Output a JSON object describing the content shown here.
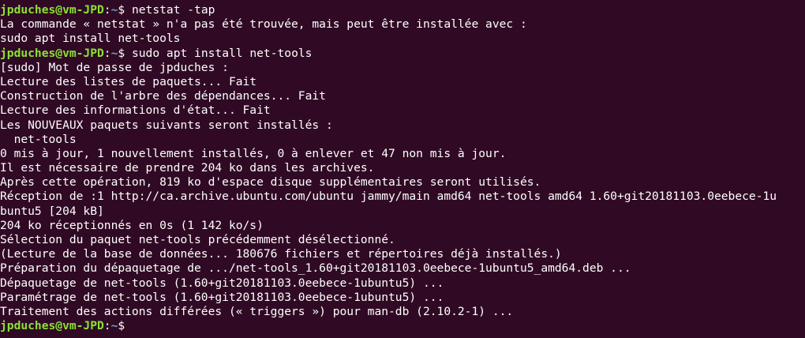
{
  "terminal": {
    "prompt_user_host": "jpduches@vm-JPD",
    "prompt_path": "~",
    "prompt_symbol": "$",
    "top_fragment": "  ~~~~ ~~~~~~~~ ~~~~~~~~~~~~ ~~~~~~~~",
    "lines": [
      {
        "type": "prompt",
        "command": "netstat -tap"
      },
      {
        "type": "text",
        "text": "La commande « netstat » n'a pas été trouvée, mais peut être installée avec :"
      },
      {
        "type": "text",
        "text": "sudo apt install net-tools"
      },
      {
        "type": "prompt",
        "command": "sudo apt install net-tools"
      },
      {
        "type": "text",
        "text": "[sudo] Mot de passe de jpduches :"
      },
      {
        "type": "text",
        "text": "Lecture des listes de paquets... Fait"
      },
      {
        "type": "text",
        "text": "Construction de l'arbre des dépendances... Fait"
      },
      {
        "type": "text",
        "text": "Lecture des informations d'état... Fait"
      },
      {
        "type": "text",
        "text": "Les NOUVEAUX paquets suivants seront installés :"
      },
      {
        "type": "text",
        "text": "  net-tools"
      },
      {
        "type": "text",
        "text": "0 mis à jour, 1 nouvellement installés, 0 à enlever et 47 non mis à jour."
      },
      {
        "type": "text",
        "text": "Il est nécessaire de prendre 204 ko dans les archives."
      },
      {
        "type": "text",
        "text": "Après cette opération, 819 ko d'espace disque supplémentaires seront utilisés."
      },
      {
        "type": "text",
        "text": "Réception de :1 http://ca.archive.ubuntu.com/ubuntu jammy/main amd64 net-tools amd64 1.60+git20181103.0eebece-1u"
      },
      {
        "type": "text",
        "text": "buntu5 [204 kB]"
      },
      {
        "type": "text",
        "text": "204 ko réceptionnés en 0s (1 142 ko/s)"
      },
      {
        "type": "text",
        "text": "Sélection du paquet net-tools précédemment désélectionné."
      },
      {
        "type": "text",
        "text": "(Lecture de la base de données... 180676 fichiers et répertoires déjà installés.)"
      },
      {
        "type": "text",
        "text": "Préparation du dépaquetage de .../net-tools_1.60+git20181103.0eebece-1ubuntu5_amd64.deb ..."
      },
      {
        "type": "text",
        "text": "Dépaquetage de net-tools (1.60+git20181103.0eebece-1ubuntu5) ..."
      },
      {
        "type": "text",
        "text": "Paramétrage de net-tools (1.60+git20181103.0eebece-1ubuntu5) ..."
      },
      {
        "type": "text",
        "text": "Traitement des actions différées (« triggers ») pour man-db (2.10.2-1) ..."
      },
      {
        "type": "prompt",
        "command": ""
      }
    ]
  },
  "colors": {
    "background": "#300a24",
    "prompt_user": "#8ae234",
    "prompt_path": "#729fcf",
    "text": "#ffffff"
  }
}
